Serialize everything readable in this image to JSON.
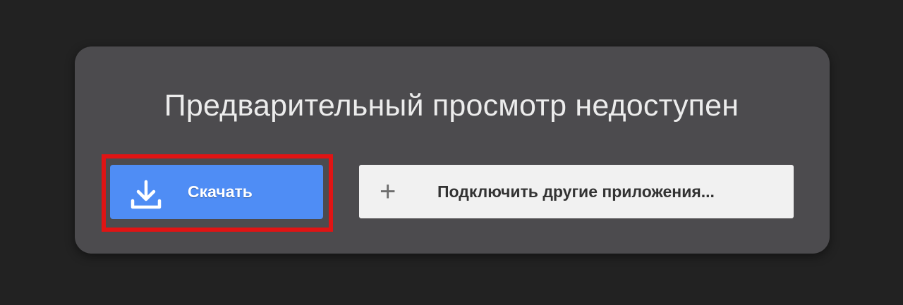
{
  "dialog": {
    "title": "Предварительный просмотр недоступен",
    "download_button": {
      "label": "Скачать",
      "icon": "download-icon"
    },
    "connect_button": {
      "label": "Подключить другие приложения...",
      "icon": "plus-icon"
    }
  },
  "colors": {
    "page_background": "#222222",
    "card_background": "#4c4b4e",
    "download_button": "#4f8df5",
    "connect_button": "#f1f1f1",
    "highlight_border": "#e01414"
  }
}
